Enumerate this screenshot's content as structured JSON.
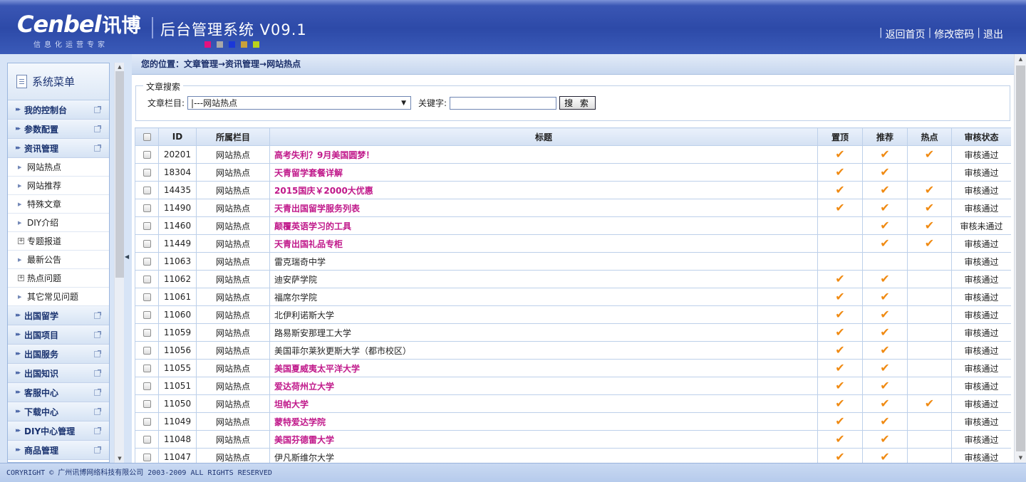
{
  "header": {
    "logo_en": "Cenbel",
    "logo_cn": "讯博",
    "logo_tagline": "信息化运营专家",
    "system_title": "后台管理系统 V09.1",
    "dot_colors": [
      "#e4117f",
      "#a8a8a8",
      "#1a37d8",
      "#c9a13a",
      "#b9d21c"
    ],
    "links": [
      "返回首页",
      "修改密码",
      "退出"
    ]
  },
  "sidebar": {
    "title": "系统菜单",
    "items": [
      {
        "type": "cat",
        "label": "我的控制台"
      },
      {
        "type": "cat",
        "label": "参数配置"
      },
      {
        "type": "cat",
        "label": "资讯管理"
      },
      {
        "type": "sub",
        "label": "网站热点",
        "marker": "bullet"
      },
      {
        "type": "sub",
        "label": "网站推荐",
        "marker": "bullet"
      },
      {
        "type": "sub",
        "label": "特殊文章",
        "marker": "bullet"
      },
      {
        "type": "sub",
        "label": "DIY介绍",
        "marker": "bullet"
      },
      {
        "type": "sub",
        "label": "专题报道",
        "marker": "plus"
      },
      {
        "type": "sub",
        "label": "最新公告",
        "marker": "bullet"
      },
      {
        "type": "sub",
        "label": "热点问题",
        "marker": "plus"
      },
      {
        "type": "sub",
        "label": "其它常见问题",
        "marker": "bullet"
      },
      {
        "type": "cat",
        "label": "出国留学"
      },
      {
        "type": "cat",
        "label": "出国项目"
      },
      {
        "type": "cat",
        "label": "出国服务"
      },
      {
        "type": "cat",
        "label": "出国知识"
      },
      {
        "type": "cat",
        "label": "客服中心"
      },
      {
        "type": "cat",
        "label": "下载中心"
      },
      {
        "type": "cat",
        "label": "DIY中心管理"
      },
      {
        "type": "cat",
        "label": "商品管理"
      }
    ]
  },
  "breadcrumb": "您的位置：文章管理→资讯管理→网站热点",
  "search": {
    "legend": "文章搜索",
    "category_label": "文章栏目:",
    "category_value": "|---网站热点",
    "keyword_label": "关键字:",
    "keyword_value": "",
    "button_label": "搜 索"
  },
  "table": {
    "headers": [
      "",
      "ID",
      "所属栏目",
      "标题",
      "置顶",
      "推荐",
      "热点",
      "审核状态"
    ],
    "rows": [
      {
        "id": "20201",
        "cat": "网站热点",
        "title": "高考失利？9月美国圆梦！",
        "hl": true,
        "top": true,
        "rec": true,
        "hot": true,
        "status": "审核通过"
      },
      {
        "id": "18304",
        "cat": "网站热点",
        "title": "天青留学套餐详解",
        "hl": true,
        "top": true,
        "rec": true,
        "hot": false,
        "status": "审核通过"
      },
      {
        "id": "14435",
        "cat": "网站热点",
        "title": " 2015国庆￥2000大优惠",
        "hl": true,
        "top": true,
        "rec": true,
        "hot": true,
        "status": "审核通过"
      },
      {
        "id": "11490",
        "cat": "网站热点",
        "title": " 天青出国留学服务列表",
        "hl": true,
        "top": true,
        "rec": true,
        "hot": true,
        "status": "审核通过"
      },
      {
        "id": "11460",
        "cat": "网站热点",
        "title": "颠覆英语学习的工具",
        "hl": true,
        "top": false,
        "rec": true,
        "hot": true,
        "status": "审核未通过"
      },
      {
        "id": "11449",
        "cat": "网站热点",
        "title": "天青出国礼品专柜",
        "hl": true,
        "top": false,
        "rec": true,
        "hot": true,
        "status": "审核通过"
      },
      {
        "id": "11063",
        "cat": "网站热点",
        "title": "雷克瑞奇中学",
        "hl": false,
        "top": false,
        "rec": false,
        "hot": false,
        "status": "审核通过"
      },
      {
        "id": "11062",
        "cat": "网站热点",
        "title": "迪安萨学院",
        "hl": false,
        "top": true,
        "rec": true,
        "hot": false,
        "status": "审核通过"
      },
      {
        "id": "11061",
        "cat": "网站热点",
        "title": "福席尔学院",
        "hl": false,
        "top": true,
        "rec": true,
        "hot": false,
        "status": "审核通过"
      },
      {
        "id": "11060",
        "cat": "网站热点",
        "title": "北伊利诺斯大学",
        "hl": false,
        "top": true,
        "rec": true,
        "hot": false,
        "status": "审核通过"
      },
      {
        "id": "11059",
        "cat": "网站热点",
        "title": "路易斯安那理工大学",
        "hl": false,
        "top": true,
        "rec": true,
        "hot": false,
        "status": "审核通过"
      },
      {
        "id": "11056",
        "cat": "网站热点",
        "title": "美国菲尔莱狄更斯大学（都市校区）",
        "hl": false,
        "top": true,
        "rec": true,
        "hot": false,
        "status": "审核通过"
      },
      {
        "id": "11055",
        "cat": "网站热点",
        "title": "美国夏威夷太平洋大学",
        "hl": true,
        "top": true,
        "rec": true,
        "hot": false,
        "status": "审核通过"
      },
      {
        "id": "11051",
        "cat": "网站热点",
        "title": "爱达荷州立大学",
        "hl": true,
        "top": true,
        "rec": true,
        "hot": false,
        "status": "审核通过"
      },
      {
        "id": "11050",
        "cat": "网站热点",
        "title": "坦帕大学",
        "hl": true,
        "top": true,
        "rec": true,
        "hot": true,
        "status": "审核通过"
      },
      {
        "id": "11049",
        "cat": "网站热点",
        "title": "蒙特爱达学院",
        "hl": true,
        "top": true,
        "rec": true,
        "hot": false,
        "status": "审核通过"
      },
      {
        "id": "11048",
        "cat": "网站热点",
        "title": "美国芬德雷大学",
        "hl": true,
        "top": true,
        "rec": true,
        "hot": false,
        "status": "审核通过"
      },
      {
        "id": "11047",
        "cat": "网站热点",
        "title": "伊凡斯维尔大学",
        "hl": false,
        "top": true,
        "rec": true,
        "hot": false,
        "status": "审核通过"
      }
    ]
  },
  "footer": "CORYRIGHT © 广州讯博网络科技有限公司 2003-2009 ALL RIGHTS RESERVED"
}
